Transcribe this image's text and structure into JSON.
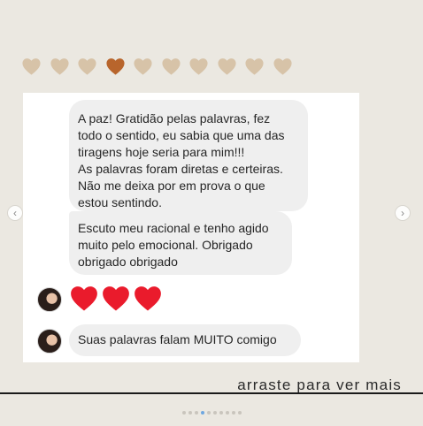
{
  "colors": {
    "heart_default": "#d7c3a8",
    "heart_active": "#b8652c",
    "heart_red": "#ea1b2c",
    "bubble_bg": "#efefef",
    "page_bg": "#ebe8e1",
    "dot_active": "#6fa7e0"
  },
  "rating": {
    "total": 10,
    "highlighted_index": 3
  },
  "messages": [
    {
      "text": "A paz! Gratidão pelas palavras, fez\ntodo o sentido, eu sabia que uma das\ntiragens hoje seria para mim!!!\nAs palavras foram diretas e certeiras.\nNão me deixa por em prova o que\nestou sentindo."
    },
    {
      "text": "Escuto meu racional e tenho agido\nmuito pelo emocional.  Obrigado\nobrigado obrigado"
    },
    {
      "text": "Suas palavras falam MUITO  comigo"
    }
  ],
  "reaction": {
    "hearts": 3,
    "icon": "red-heart-icon"
  },
  "caption": "arraste para ver mais",
  "navigation": {
    "prev_icon": "chevron-left-icon",
    "next_icon": "chevron-right-icon",
    "prev_glyph": "‹",
    "next_glyph": "›"
  },
  "pagination": {
    "total": 10,
    "active": 3
  }
}
